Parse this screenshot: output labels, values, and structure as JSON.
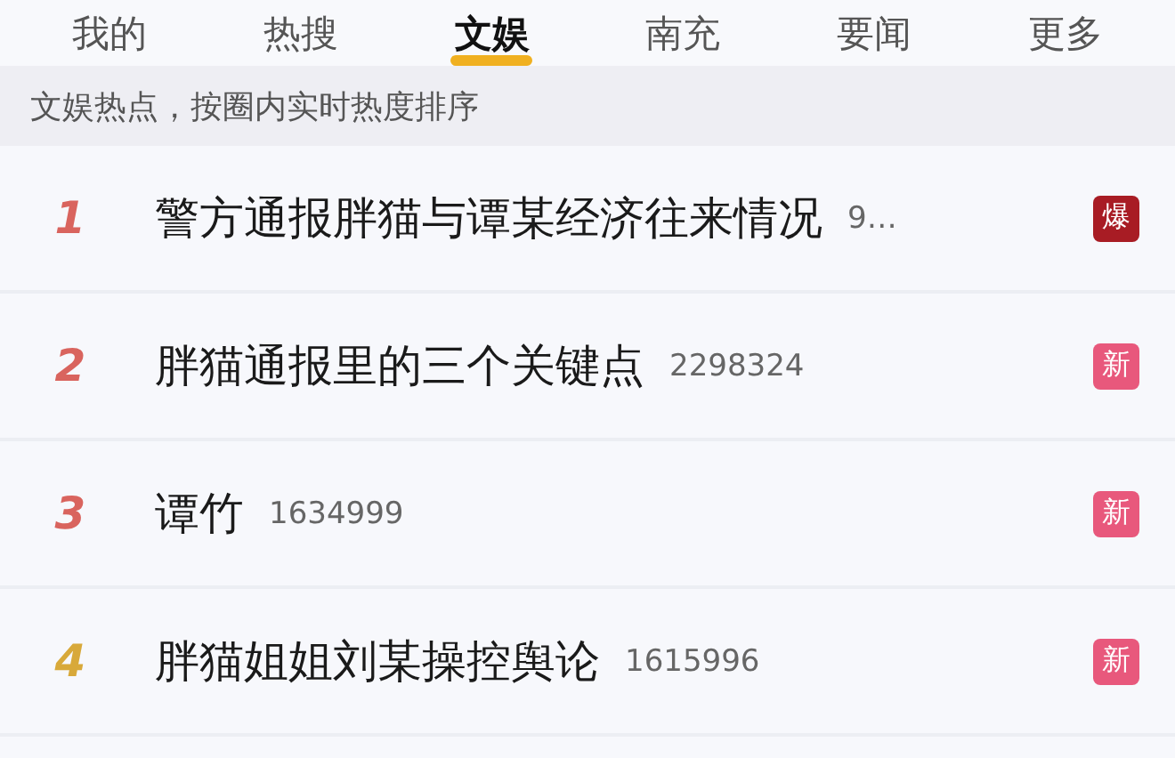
{
  "tabs": [
    {
      "label": "我的",
      "selected": false
    },
    {
      "label": "热搜",
      "selected": false
    },
    {
      "label": "文娱",
      "selected": true
    },
    {
      "label": "南充",
      "selected": false
    },
    {
      "label": "要闻",
      "selected": false
    },
    {
      "label": "更多",
      "selected": false
    }
  ],
  "notice": "文娱热点，按圈内实时热度排序",
  "items": [
    {
      "rank": "1",
      "color": "#d9645e",
      "title": "警方通报胖猫与谭某经济往来情况",
      "count": "9…",
      "badge": {
        "kind": "hot",
        "label": "爆"
      }
    },
    {
      "rank": "2",
      "color": "#d9645e",
      "title": "胖猫通报里的三个关键点",
      "count": "2298324",
      "badge": {
        "kind": "new",
        "label": "新"
      }
    },
    {
      "rank": "3",
      "color": "#d9645e",
      "title": "谭竹",
      "count": "1634999",
      "badge": {
        "kind": "new",
        "label": "新"
      }
    },
    {
      "rank": "4",
      "color": "#d8a93a",
      "title": "胖猫姐姐刘某操控舆论",
      "count": "1615996",
      "badge": {
        "kind": "new",
        "label": "新"
      }
    }
  ]
}
